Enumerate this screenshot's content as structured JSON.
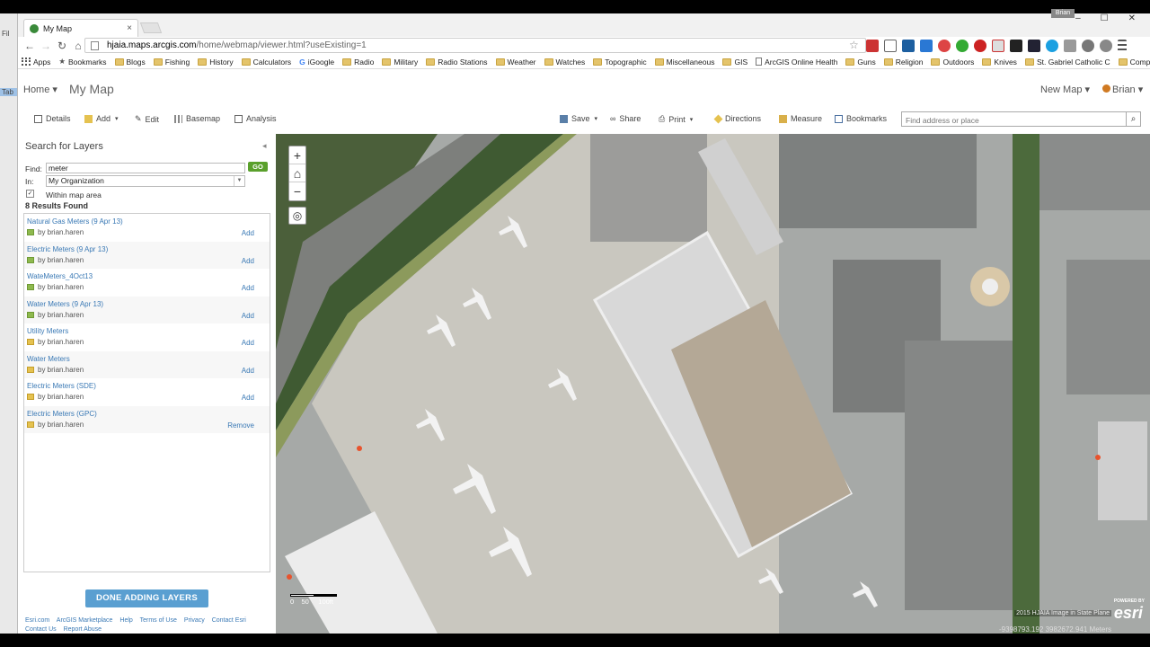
{
  "browser": {
    "tab_title": "My Map",
    "tab_close": "×",
    "window_user": "Brian",
    "window_controls": [
      "–",
      "☐",
      "✕"
    ],
    "url_domain": "hjaia.maps.arcgis.com",
    "url_path": "/home/webmap/viewer.html?useExisting=1",
    "bookmarks": [
      {
        "label": "Apps",
        "icon": "apps-icon"
      },
      {
        "label": "Bookmarks",
        "icon": "star-icon"
      },
      {
        "label": "Blogs",
        "icon": "folder-icon"
      },
      {
        "label": "Fishing",
        "icon": "folder-icon"
      },
      {
        "label": "History",
        "icon": "folder-icon"
      },
      {
        "label": "Calculators",
        "icon": "folder-icon"
      },
      {
        "label": "iGoogle",
        "icon": "google-icon"
      },
      {
        "label": "Radio",
        "icon": "folder-icon"
      },
      {
        "label": "Military",
        "icon": "folder-icon"
      },
      {
        "label": "Radio Stations",
        "icon": "folder-icon"
      },
      {
        "label": "Weather",
        "icon": "folder-icon"
      },
      {
        "label": "Watches",
        "icon": "folder-icon"
      },
      {
        "label": "Topographic",
        "icon": "folder-icon"
      },
      {
        "label": "Miscellaneous",
        "icon": "folder-icon"
      },
      {
        "label": "GIS",
        "icon": "folder-icon"
      },
      {
        "label": "ArcGIS Online Health",
        "icon": "page-icon"
      },
      {
        "label": "Guns",
        "icon": "folder-icon"
      },
      {
        "label": "Religion",
        "icon": "folder-icon"
      },
      {
        "label": "Outdoors",
        "icon": "folder-icon"
      },
      {
        "label": "Knives",
        "icon": "folder-icon"
      },
      {
        "label": "St. Gabriel Catholic C",
        "icon": "folder-icon"
      },
      {
        "label": "Computers",
        "icon": "folder-icon"
      }
    ],
    "bookmarks_more": "»",
    "left_strip": [
      "Fil",
      "Tab"
    ]
  },
  "header": {
    "home": "Home ▾",
    "title": "My Map",
    "new_map": "New Map ▾",
    "user": "Brian ▾"
  },
  "toolbar": {
    "details": "Details",
    "add": "Add",
    "edit": "Edit",
    "basemap": "Basemap",
    "analysis": "Analysis",
    "save": "Save",
    "share": "Share",
    "print": "Print",
    "directions": "Directions",
    "measure": "Measure",
    "bookmarks": "Bookmarks",
    "search_placeholder": "Find address or place"
  },
  "sidebar": {
    "title": "Search for Layers",
    "find_label": "Find:",
    "find_value": "meter",
    "go": "GO",
    "in_label": "In:",
    "in_value": "My Organization",
    "within_checkbox": "✓",
    "within_label": "Within map area",
    "results_count": "8 Results Found",
    "results": [
      {
        "title": "Natural Gas Meters (9 Apr 13)",
        "by": "by brian.haren",
        "action": "Add",
        "icon": "green"
      },
      {
        "title": "Electric Meters (9 Apr 13)",
        "by": "by brian.haren",
        "action": "Add",
        "icon": "green"
      },
      {
        "title": "WateMeters_4Oct13",
        "by": "by brian.haren",
        "action": "Add",
        "icon": "green"
      },
      {
        "title": "Water Meters (9 Apr 13)",
        "by": "by brian.haren",
        "action": "Add",
        "icon": "green"
      },
      {
        "title": "Utility Meters",
        "by": "by brian.haren",
        "action": "Add",
        "icon": "yellow"
      },
      {
        "title": "Water Meters",
        "by": "by brian.haren",
        "action": "Add",
        "icon": "yellow"
      },
      {
        "title": "Electric Meters (SDE)",
        "by": "by brian.haren",
        "action": "Add",
        "icon": "yellow"
      },
      {
        "title": "Electric Meters (GPC)",
        "by": "by brian.haren",
        "action": "Remove",
        "icon": "yellow"
      }
    ],
    "done_button": "DONE ADDING LAYERS",
    "footer_links": [
      "Esri.com",
      "ArcGIS Marketplace",
      "Help",
      "Terms of Use",
      "Privacy",
      "Contact Esri",
      "Contact Us",
      "Report Abuse"
    ]
  },
  "map": {
    "zoom_in": "+",
    "home": "⌂",
    "zoom_out": "−",
    "locate": "◎",
    "scale_ticks": [
      "0",
      "50",
      "100ft"
    ],
    "attribution": "2015 HJAIA Image in State Plane",
    "logo_caption": "POWERED BY",
    "logo_text": "esri",
    "coordinates": "-9398793.192  3982672.941 Meters"
  },
  "colors": {
    "link": "#3a79b5",
    "go_button": "#5aa02c",
    "done_button": "#5a9fd1",
    "apron": "#c9c7bf",
    "grass": "#6b8a4a",
    "roof": "#d8d8d8"
  }
}
